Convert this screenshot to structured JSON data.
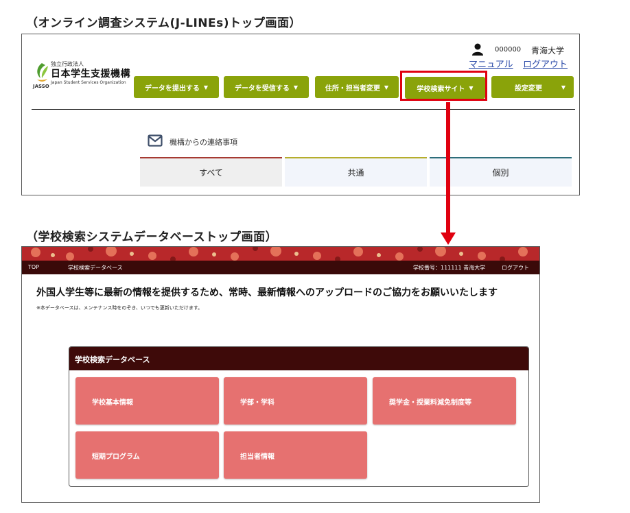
{
  "captions": {
    "top": "（オンライン調査システム(J-LINEs)トップ画面）",
    "bottom": "（学校検索システムデータベーストップ画面）"
  },
  "jlines": {
    "logo": {
      "org_type": "独立行政法人",
      "name": "日本学生支援機構",
      "abbr": "JASSO",
      "english": "Japan Student Services Organization"
    },
    "user": {
      "code": "000000",
      "school": "青海大学"
    },
    "links": {
      "manual": "マニュアル",
      "logout": "ログアウト"
    },
    "menu": [
      {
        "label": "データを提出する"
      },
      {
        "label": "データを受信する"
      },
      {
        "label": "住所・担当者変更"
      },
      {
        "label": "学校検索サイト"
      },
      {
        "label": "設定変更"
      }
    ],
    "notice_label": "機構からの連絡事項",
    "tabs": [
      "すべて",
      "共通",
      "個別"
    ],
    "colors": {
      "menu_green": "#8aa30a",
      "highlight_red": "#e0000f"
    }
  },
  "schooldb": {
    "nav": {
      "top": "TOP",
      "db": "学校検索データベース",
      "school": "学校番号：111111 青海大学",
      "logout": "ログアウト"
    },
    "headline": "外国人学生等に最新の情報を提供するため、常時、最新情報へのアップロードのご協力をお願いいたします",
    "note": "※本データベースは、メンテナンス時をのぞき、いつでも更新いただけます。",
    "card_title": "学校検索データベース",
    "buttons": [
      "学校基本情報",
      "学部・学科",
      "奨学金・授業料減免制度等",
      "短期プログラム",
      "担当者情報"
    ],
    "colors": {
      "header_dark": "#3e0a09",
      "button_pink": "#e67170"
    }
  }
}
